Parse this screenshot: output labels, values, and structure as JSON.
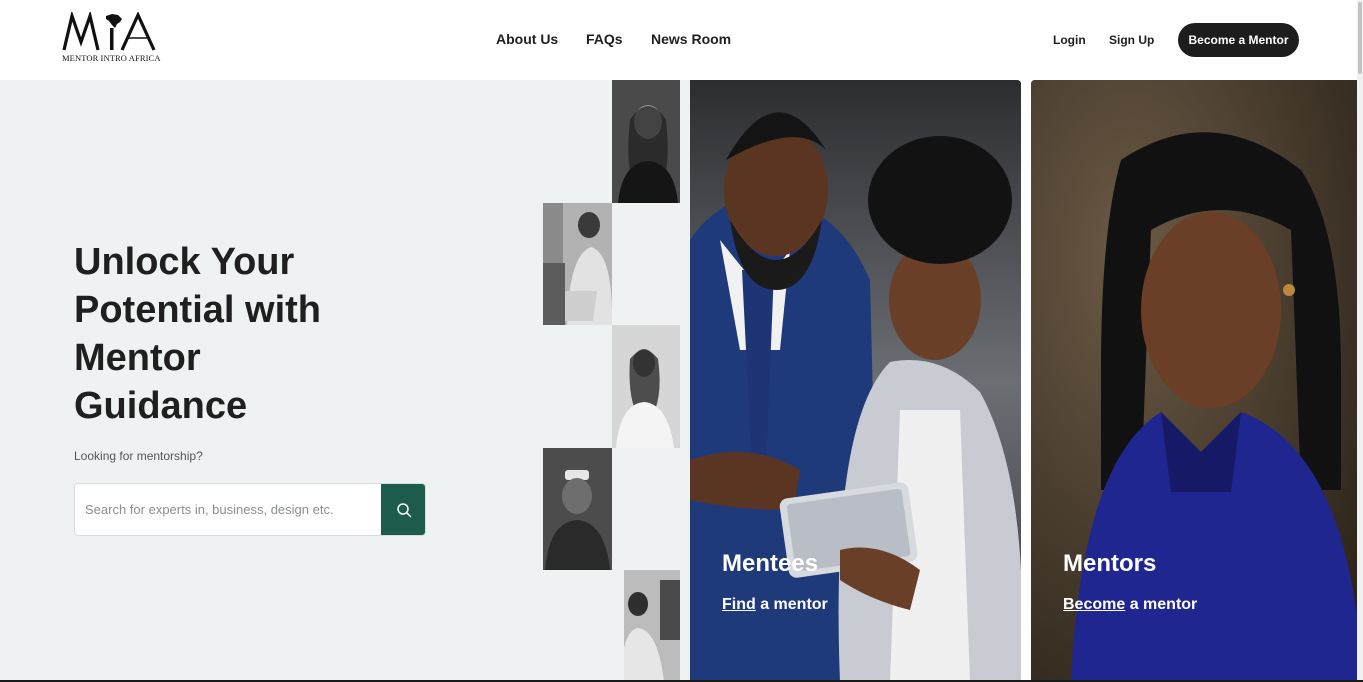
{
  "header": {
    "logo_text": "MIA",
    "logo_subtext": "MENTOR INTRO AFRICA",
    "nav": [
      {
        "label": "About Us"
      },
      {
        "label": "FAQs"
      },
      {
        "label": "News Room"
      }
    ],
    "login_label": "Login",
    "signup_label": "Sign Up",
    "become_mentor_label": "Become a Mentor"
  },
  "hero": {
    "headline_lines": [
      "Unlock Your",
      "Potential with",
      "Mentor",
      "Guidance"
    ],
    "subtext": "Looking for mentorship?",
    "search": {
      "placeholder": "Search for experts in, business, design etc.",
      "value": "",
      "button_icon": "search-icon"
    }
  },
  "cards": {
    "mentees": {
      "title": "Mentees",
      "link_underlined": "Find",
      "link_rest": " a mentor"
    },
    "mentors": {
      "title": "Mentors",
      "link_underlined": "Become",
      "link_rest": " a mentor"
    }
  },
  "colors": {
    "accent": "#1d5c4d",
    "button_dark": "#1d1d1d",
    "hero_bg": "#eff2f2"
  }
}
